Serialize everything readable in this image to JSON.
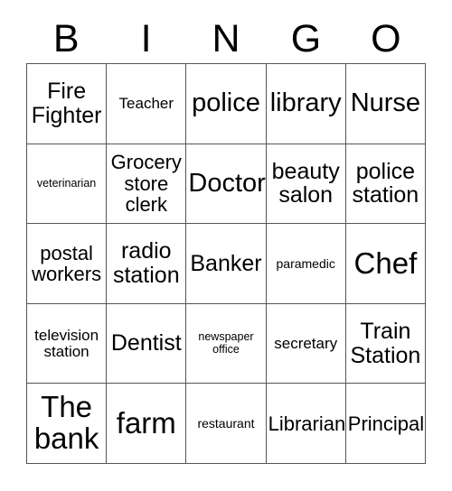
{
  "card": {
    "title": "BINGO",
    "header_letters": [
      "B",
      "I",
      "N",
      "G",
      "O"
    ],
    "columns": 5,
    "rows": 5,
    "grid_color": "#555555",
    "background_color": "#ffffff",
    "text_color": "#000000",
    "cells": [
      [
        {
          "text": "Fire Fighter",
          "size": "lg"
        },
        {
          "text": "Teacher",
          "size": "sm"
        },
        {
          "text": "police",
          "size": "xl"
        },
        {
          "text": "library",
          "size": "xl"
        },
        {
          "text": "Nurse",
          "size": "xl"
        }
      ],
      [
        {
          "text": "veterinarian",
          "size": "xxs"
        },
        {
          "text": "Grocery store clerk",
          "size": "md"
        },
        {
          "text": "Doctor",
          "size": "xl"
        },
        {
          "text": "beauty salon",
          "size": "lg"
        },
        {
          "text": "police station",
          "size": "lg"
        }
      ],
      [
        {
          "text": "postal workers",
          "size": "md"
        },
        {
          "text": "radio station",
          "size": "lg"
        },
        {
          "text": "Banker",
          "size": "lg"
        },
        {
          "text": "paramedic",
          "size": "xs"
        },
        {
          "text": "Chef",
          "size": "xxl"
        }
      ],
      [
        {
          "text": "television station",
          "size": "sm"
        },
        {
          "text": "Dentist",
          "size": "lg"
        },
        {
          "text": "newspaper office",
          "size": "xxs"
        },
        {
          "text": "secretary",
          "size": "sm"
        },
        {
          "text": "Train Station",
          "size": "lg"
        }
      ],
      [
        {
          "text": "The bank",
          "size": "xxl"
        },
        {
          "text": "farm",
          "size": "xxl"
        },
        {
          "text": "restaurant",
          "size": "xs"
        },
        {
          "text": "Librarian",
          "size": "md"
        },
        {
          "text": "Principal",
          "size": "md"
        }
      ]
    ]
  }
}
